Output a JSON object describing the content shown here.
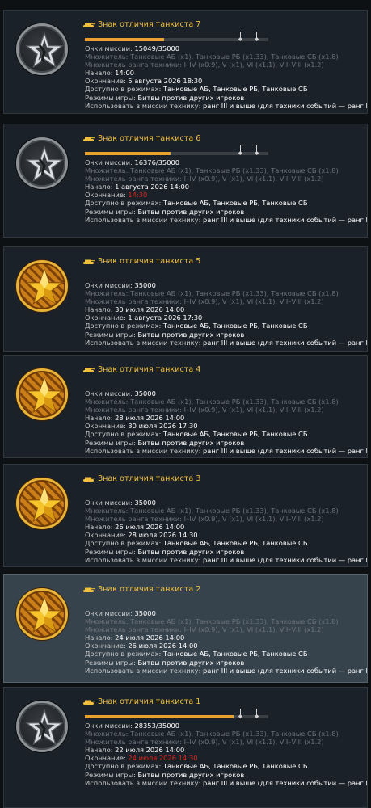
{
  "labels": {
    "points": "Очки миссии:",
    "multiplier": "Множитель:",
    "rank_multiplier": "Множитель ранга техники:",
    "start": "Начало:",
    "end": "Окончание:",
    "available": "Доступно в режимах:",
    "game_modes": "Режимы игры:",
    "use_vehicles": "Использовать в миссии технику:"
  },
  "common": {
    "multiplier": "Танковые АБ (x1), Танковые РБ (x1.33), Танковые СБ (x1.8)",
    "rank_multiplier": "I–IV (x0.9), V (x1), VI (x1.1), VII–VIII (x1.2)",
    "available": "Танковые АБ, Танковые РБ, Танковые СБ",
    "game_modes": "Битвы против других игроков",
    "use_vehicles": "ранг III и выше (для техники событий — ранг I и выше)"
  },
  "colors": {
    "title": "#f0c03d",
    "progress": "#e8a12c",
    "expired_date": "#e0241b",
    "selected_bg": "#37434c"
  },
  "missions": [
    {
      "title": "Знак отличия танкиста 7",
      "medal": "gray-star-medal-icon",
      "progress": 0.4299,
      "marks": true,
      "points": "15049/35000",
      "start": "14:00",
      "end": "5 августа 2026 18:30",
      "end_expired": false,
      "start_first": false,
      "selected": false
    },
    {
      "title": "Знак отличия танкиста 6",
      "medal": "gray-star-medal-icon",
      "progress": 0.4679,
      "marks": true,
      "points": "16376/35000",
      "start": "1 августа 2026 14:00",
      "end": "14:30",
      "end_expired": true,
      "start_first": false,
      "selected": false
    },
    {
      "title": "Знак отличия танкиста 5",
      "medal": "gold-star-medal-icon",
      "progress": null,
      "marks": false,
      "points": "35000",
      "start": "30 июля 2026 14:00",
      "end": "1 августа 2026 17:30",
      "end_expired": false,
      "start_first": false,
      "selected": false
    },
    {
      "title": "Знак отличия танкиста 4",
      "medal": "gold-star-medal-icon",
      "progress": null,
      "marks": false,
      "points": "35000",
      "start": "28 июля 2026 14:00",
      "end": "30 июля 2026 17:30",
      "end_expired": false,
      "start_first": true,
      "selected": false
    },
    {
      "title": "Знак отличия танкиста 3",
      "medal": "gold-star-medal-icon",
      "progress": null,
      "marks": false,
      "points": "35000",
      "start": "26 июля 2026 14:00",
      "end": "28 июля 2026 14:30",
      "end_expired": false,
      "start_first": false,
      "selected": false
    },
    {
      "title": "Знак отличия танкиста 2",
      "medal": "gold-star-medal-icon",
      "progress": null,
      "marks": false,
      "points": "35000",
      "start": "24 июля 2026 14:00",
      "end": "26 июля 2026 14:00",
      "end_expired": false,
      "start_first": false,
      "selected": true
    },
    {
      "title": "Знак отличия танкиста 1",
      "medal": "gray-star-medal-icon",
      "progress": 0.8101,
      "marks": true,
      "points": "28353/35000",
      "start": "22 июля 2026 14:00",
      "end": "24 июля 2026 14:30",
      "end_expired": true,
      "start_first": false,
      "selected": false
    }
  ]
}
